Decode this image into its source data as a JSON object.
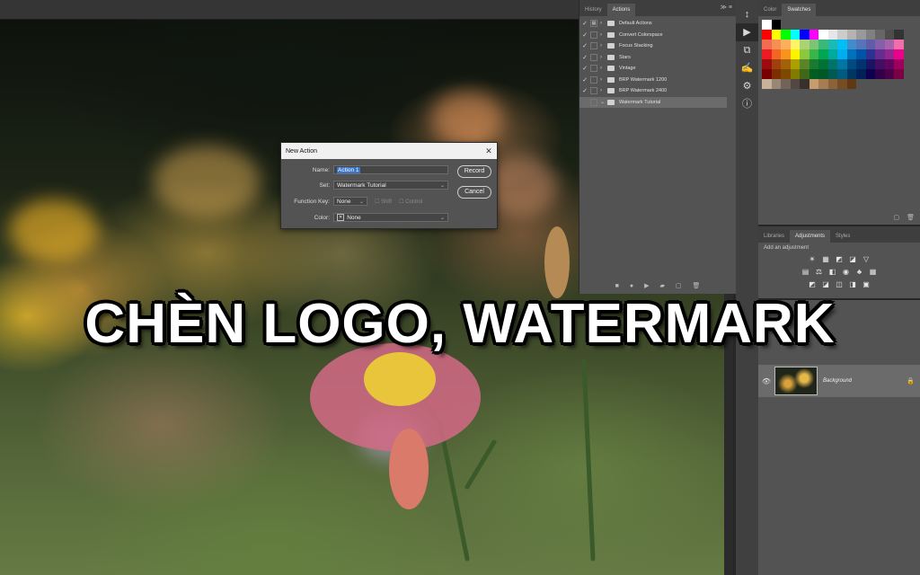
{
  "caption": "CHÈN LOGO, WATERMARK",
  "actions_panel": {
    "tabs": [
      "History",
      "Actions"
    ],
    "active_tab": "Actions",
    "menu_glyph": "≫ ≡",
    "items": [
      {
        "label": "Default Actions",
        "checked": true
      },
      {
        "label": "Convert Colorspace",
        "checked": true
      },
      {
        "label": "Focus Stacking",
        "checked": true
      },
      {
        "label": "Stars",
        "checked": true
      },
      {
        "label": "Vintage",
        "checked": true
      },
      {
        "label": "BRP Watermark 1200",
        "checked": true
      },
      {
        "label": "BRP Watermark 2400",
        "checked": true
      },
      {
        "label": "Watermark Tutorial",
        "checked": false,
        "selected": true
      }
    ],
    "bottom_icons": [
      "stop-icon",
      "record-icon",
      "play-icon",
      "folder-icon",
      "new-icon",
      "trash-icon"
    ]
  },
  "swatches_panel": {
    "tabs": [
      "Color",
      "Swatches"
    ],
    "active_tab": "Swatches",
    "colors": [
      "#ffffff",
      "#000000",
      "#ff0000",
      "#ffff00",
      "#00ff00",
      "#00ffff",
      "#0000ff",
      "#ff00ff",
      "#ffffff",
      "#e6e6e6",
      "#cccccc",
      "#b3b3b3",
      "#999999",
      "#808080",
      "#666666",
      "#4d4d4d",
      "#333333",
      "#f26c4f",
      "#f68e55",
      "#fbaf5c",
      "#fff467",
      "#acd372",
      "#7cc576",
      "#3bb878",
      "#1abbb4",
      "#00bff3",
      "#438ccb",
      "#5574b9",
      "#605ca8",
      "#855fa8",
      "#a763a9",
      "#f06eaa",
      "#ed1c24",
      "#f26522",
      "#f7941d",
      "#fff200",
      "#8dc63f",
      "#39b54a",
      "#00a651",
      "#00a99d",
      "#00aeef",
      "#0072bc",
      "#0054a6",
      "#2e3192",
      "#662d91",
      "#92278f",
      "#ec008c",
      "#9e0b0f",
      "#a0410d",
      "#a3620a",
      "#aba000",
      "#598527",
      "#197b30",
      "#007236",
      "#00746b",
      "#0076a3",
      "#004a80",
      "#003471",
      "#1b1464",
      "#440e62",
      "#630460",
      "#9e005d",
      "#790000",
      "#7b2e00",
      "#7d4900",
      "#827b00",
      "#406618",
      "#005e20",
      "#005826",
      "#005952",
      "#005b7f",
      "#003663",
      "#002157",
      "#0d004c",
      "#32004b",
      "#4b0049",
      "#7b0046",
      "#c7b299",
      "#998675",
      "#736357",
      "#534741",
      "#37302d",
      "#c69c6d",
      "#a67c52",
      "#8c6239",
      "#754c24",
      "#603913"
    ],
    "footer_icons": "▢ 🗑"
  },
  "adjustments_panel": {
    "tabs": [
      "Libraries",
      "Adjustments",
      "Styles"
    ],
    "active_tab": "Adjustments",
    "hint": "Add an adjustment",
    "rows": [
      [
        "☀",
        "▦",
        "◩",
        "◪",
        "▽"
      ],
      [
        "▤",
        "⚖",
        "◧",
        "◉",
        "♣",
        "▦"
      ],
      [
        "◩",
        "◪",
        "◫",
        "◨",
        "▣"
      ]
    ]
  },
  "layers_panel": {
    "layer_name": "Background",
    "eye": "👁",
    "lock": "🔒"
  },
  "dialog": {
    "title": "New Action",
    "close": "✕",
    "name_label": "Name:",
    "name_value": "Action 1",
    "set_label": "Set:",
    "set_value": "Watermark Tutorial",
    "fkey_label": "Function Key:",
    "fkey_value": "None",
    "shift_label": "Shift",
    "control_label": "Control",
    "color_label": "Color:",
    "color_prefix": "✕",
    "color_value": "None",
    "record_button": "Record",
    "cancel_button": "Cancel"
  },
  "vertical_toolbar": [
    "↕",
    "▶",
    "⧉",
    "✍",
    "⚙",
    "ⓘ"
  ]
}
